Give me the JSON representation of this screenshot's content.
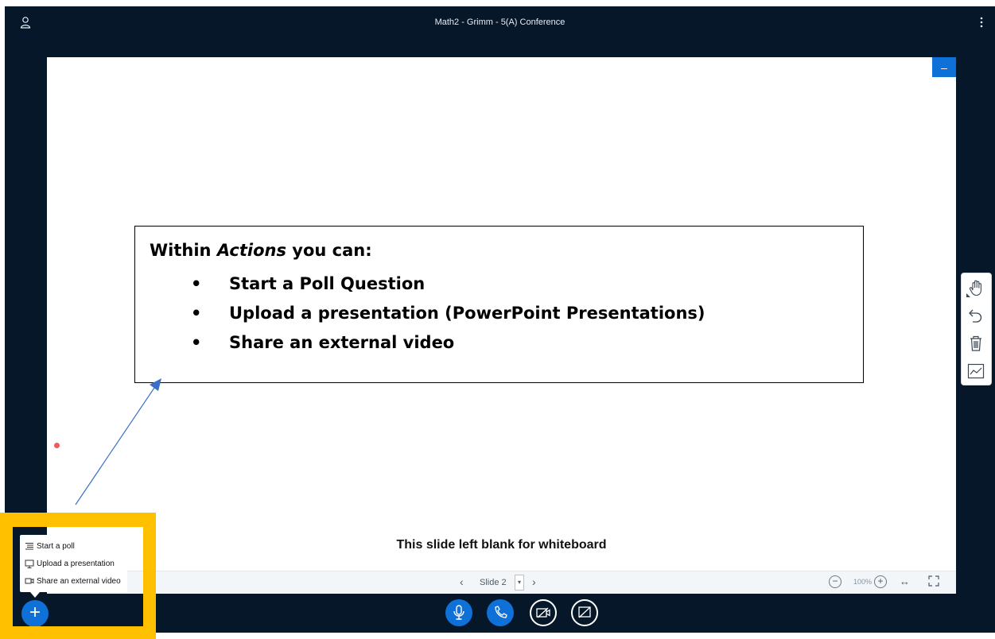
{
  "window": {
    "title": "Math2 - Grimm - 5(A) Conference"
  },
  "presentation": {
    "callout": {
      "heading_prefix": "Within ",
      "heading_em": "Actions",
      "heading_suffix": " you can:",
      "bullet": "•",
      "items": [
        "Start a Poll Question",
        "Upload a presentation (PowerPoint Presentations)",
        "Share an external video"
      ]
    },
    "slide_caption": "This slide left blank for whiteboard",
    "toolbar": {
      "prev": "‹",
      "slide_label": "Slide 2",
      "select_caret": "▾",
      "next": "›",
      "zoom_out": "−",
      "zoom_level": "100%",
      "zoom_in": "+",
      "fit_width": "↔"
    },
    "minimize": "–"
  },
  "actions_menu": {
    "items": [
      "Start a poll",
      "Upload a presentation",
      "Share an external video"
    ]
  },
  "action_button": "+",
  "icons": {
    "user": "user-icon",
    "more": "more-vertical-icon",
    "hand": "hand-icon",
    "undo": "undo-icon",
    "trash": "trash-icon",
    "chart": "line-chart-icon",
    "microphone": "microphone-icon",
    "phone": "phone-icon",
    "camera_off": "camera-off-icon",
    "screen_share_off": "screen-share-off-icon"
  },
  "colors": {
    "app_background": "#06172a",
    "accent_blue": "#0f70d7",
    "highlight": "#ffc000",
    "laser_pointer": "#f15a5a",
    "annotation_arrow": "#3a6fc8"
  }
}
